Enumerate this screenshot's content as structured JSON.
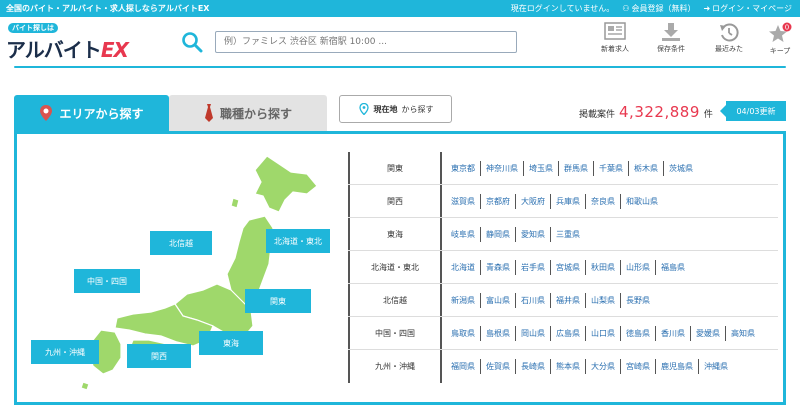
{
  "topbar": {
    "tagline": "全国のバイト・アルバイト・求人探しならアルバイトEX",
    "not_logged_in": "現在ログインしていません。",
    "register": "会員登録（無料）",
    "login": "ログイン・マイページ"
  },
  "logo": {
    "small": "バイト探しは",
    "main": "アルバイト",
    "ex": "EX"
  },
  "search": {
    "placeholder": "例）ファミレス 渋谷区 新宿駅 10:00 ..."
  },
  "header_icons": [
    {
      "label": "新着求人",
      "icon": "newspaper-icon"
    },
    {
      "label": "保存条件",
      "icon": "download-icon"
    },
    {
      "label": "最近みた",
      "icon": "history-icon"
    },
    {
      "label": "キープ",
      "icon": "star-icon",
      "badge": "0"
    }
  ],
  "tabs": {
    "area": "エリアから探す",
    "job": "職種から探す"
  },
  "geo_button": {
    "strong": "現在地",
    "rest": "から探す"
  },
  "count": {
    "label": "掲載案件",
    "value": "4,322,889",
    "unit": "件"
  },
  "update": "04/03更新",
  "map_labels": {
    "hokushinetsu": "北信越",
    "hokkaido_tohoku": "北海道・東北",
    "chugoku_shikoku": "中国・四国",
    "kanto": "関東",
    "kyushu_okinawa": "九州・沖縄",
    "tokai": "東海",
    "kansai": "関西"
  },
  "regions": [
    {
      "name": "関東",
      "prefs": [
        "東京都",
        "神奈川県",
        "埼玉県",
        "群馬県",
        "千葉県",
        "栃木県",
        "茨城県"
      ]
    },
    {
      "name": "関西",
      "prefs": [
        "滋賀県",
        "京都府",
        "大阪府",
        "兵庫県",
        "奈良県",
        "和歌山県"
      ]
    },
    {
      "name": "東海",
      "prefs": [
        "岐阜県",
        "静岡県",
        "愛知県",
        "三重県"
      ]
    },
    {
      "name": "北海道・東北",
      "prefs": [
        "北海道",
        "青森県",
        "岩手県",
        "宮城県",
        "秋田県",
        "山形県",
        "福島県"
      ]
    },
    {
      "name": "北信越",
      "prefs": [
        "新潟県",
        "富山県",
        "石川県",
        "福井県",
        "山梨県",
        "長野県"
      ]
    },
    {
      "name": "中国・四国",
      "prefs": [
        "鳥取県",
        "島根県",
        "岡山県",
        "広島県",
        "山口県",
        "徳島県",
        "香川県",
        "愛媛県",
        "高知県"
      ]
    },
    {
      "name": "九州・沖縄",
      "prefs": [
        "福岡県",
        "佐賀県",
        "長崎県",
        "熊本県",
        "大分県",
        "宮崎県",
        "鹿児島県",
        "沖縄県"
      ]
    }
  ],
  "colors": {
    "brand": "#1fb6da",
    "map_green": "#9fd86b",
    "count_red": "#e8384f",
    "link_blue": "#2a6fb0"
  }
}
